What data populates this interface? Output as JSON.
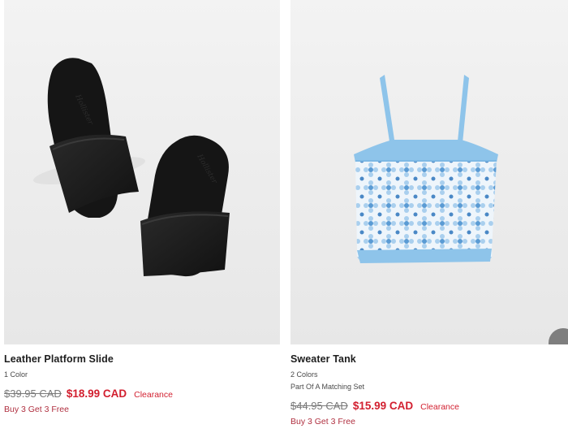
{
  "products": [
    {
      "name": "Leather Platform Slide",
      "colors": "1 Color",
      "price_old": "$39.95 CAD",
      "price_new": "$18.99 CAD",
      "badge": "Clearance",
      "promo": "Buy 3 Get 3 Free"
    },
    {
      "name": "Sweater Tank",
      "colors": "2 Colors",
      "note": "Part Of A Matching Set",
      "price_old": "$44.95 CAD",
      "price_new": "$15.99 CAD",
      "badge": "Clearance",
      "promo": "Buy 3 Get 3 Free"
    }
  ],
  "colors": {
    "sale_red": "#d21f2f",
    "strike_gray": "#7a7a7a",
    "tank_blue": "#8ec4ea"
  }
}
